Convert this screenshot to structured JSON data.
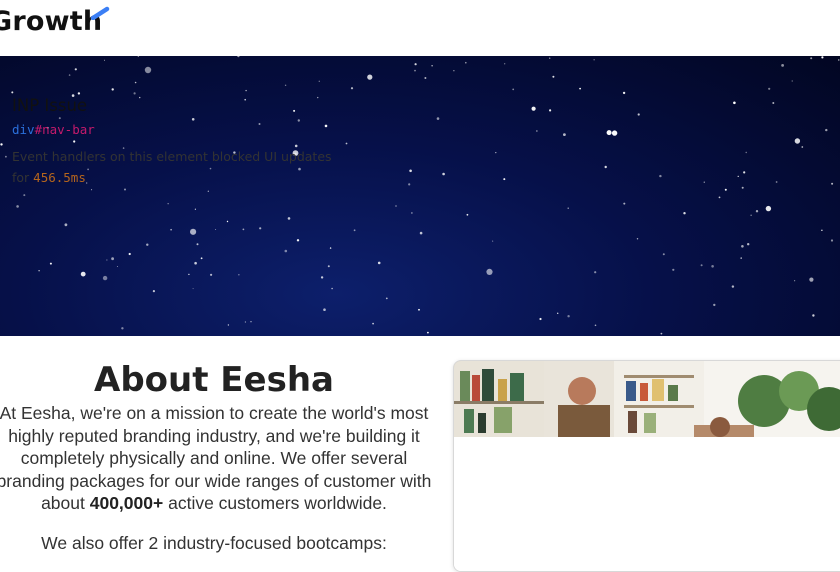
{
  "header": {
    "logo_text": "Growth",
    "accent_color": "#3b7ff5"
  },
  "hero": {
    "image": "starry-night-sky"
  },
  "about": {
    "title": "About Eesha",
    "paragraph_before_bold": "At Eesha, we're on a mission to create the world's most highly reputed branding industry, and we're building it completely physically and online. We offer several branding packages for our wide ranges of customer with about",
    "paragraph_bold": "400,000+",
    "paragraph_after_bold": "active customers worldwide.",
    "paragraph_2": "We also offer 2 industry-focused bootcamps:"
  },
  "inp_card": {
    "image": "people-working-in-office",
    "title": "INP Issue",
    "selector_tag": "div",
    "selector_id": "#nav-bar",
    "description": "Event handlers on this element blocked UI updates for",
    "duration": "456.5ms"
  }
}
